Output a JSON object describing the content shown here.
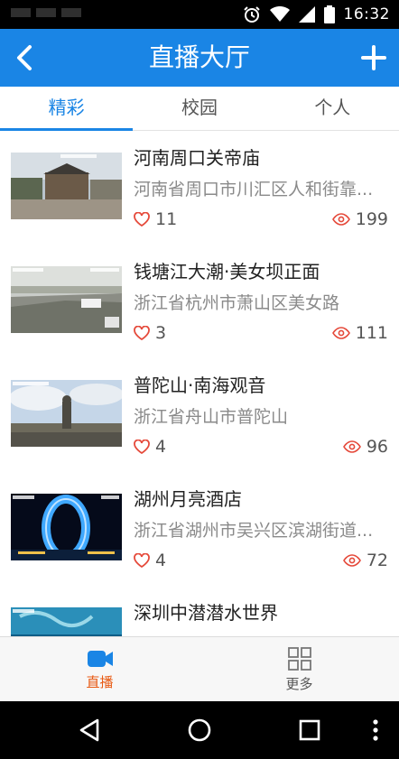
{
  "status_bar": {
    "time": "16:32",
    "icons": [
      "alarm-icon",
      "wifi-icon",
      "signal-icon",
      "battery-icon"
    ]
  },
  "app_bar": {
    "title": "直播大厅",
    "back_icon": "chevron-left-icon",
    "add_icon": "plus-icon",
    "background": "#1a85e5"
  },
  "tabs": [
    {
      "label": "精彩",
      "active": true
    },
    {
      "label": "校园",
      "active": false
    },
    {
      "label": "个人",
      "active": false
    }
  ],
  "streams": [
    {
      "title": "河南周口关帝庙",
      "address": "河南省周口市川汇区人和街靠...",
      "likes": "11",
      "views": "199"
    },
    {
      "title": "钱塘江大潮·美女坝正面",
      "address": "浙江省杭州市萧山区美女路",
      "likes": "3",
      "views": "111"
    },
    {
      "title": "普陀山·南海观音",
      "address": "浙江省舟山市普陀山",
      "likes": "4",
      "views": "96"
    },
    {
      "title": "湖州月亮酒店",
      "address": "浙江省湖州市吴兴区滨湖街道...",
      "likes": "4",
      "views": "72"
    },
    {
      "title": "深圳中潜潜水世界",
      "address": "",
      "likes": "",
      "views": ""
    }
  ],
  "bottom_nav": [
    {
      "label": "直播",
      "icon": "video-camera-icon",
      "active": true
    },
    {
      "label": "更多",
      "icon": "grid-icon",
      "active": false
    }
  ],
  "colors": {
    "accent": "#1a85e5",
    "active_nav": "#e85a13",
    "like": "#e5493a",
    "view": "#e5493a"
  }
}
